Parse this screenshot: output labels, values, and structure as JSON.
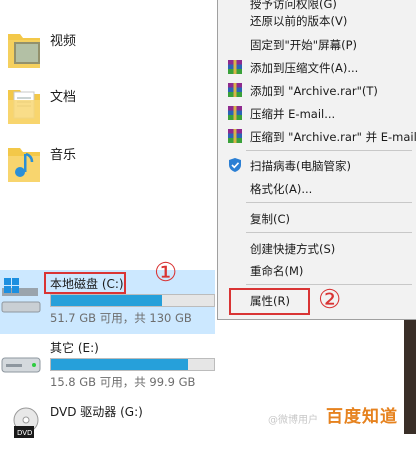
{
  "folders": [
    {
      "label": "视频",
      "icon": "video-folder-icon"
    },
    {
      "label": "文档",
      "icon": "document-folder-icon"
    },
    {
      "label": "音乐",
      "icon": "music-folder-icon"
    }
  ],
  "drives": [
    {
      "name": "本地磁盘 (C:)",
      "space": "51.7 GB 可用，共 130 GB",
      "used_fraction": 0.6,
      "icon": "windows-drive-icon",
      "selected": true
    },
    {
      "name": "其它 (E:)",
      "space": "15.8 GB 可用，共 99.9 GB",
      "used_fraction": 0.84,
      "icon": "hard-drive-icon",
      "selected": false
    },
    {
      "name": "DVD 驱动器 (G:)",
      "icon": "dvd-drive-icon"
    }
  ],
  "annotations": {
    "circle_one": "①",
    "circle_two": "②"
  },
  "context_menu": {
    "items": [
      {
        "label": "授予访问权限(G)"
      },
      {
        "label": "还原以前的版本(V)"
      },
      {
        "label": "固定到\"开始\"屏幕(P)"
      },
      {
        "label": "添加到压缩文件(A)...",
        "icon": "winrar-icon"
      },
      {
        "label": "添加到 \"Archive.rar\"(T)",
        "icon": "winrar-icon"
      },
      {
        "label": "压缩并 E-mail...",
        "icon": "winrar-icon"
      },
      {
        "label": "压缩到 \"Archive.rar\" 并 E-mail",
        "icon": "winrar-icon"
      },
      {
        "label": "扫描病毒(电脑管家)",
        "icon": "shield-icon"
      },
      {
        "label": "格式化(A)..."
      },
      {
        "label": "复制(C)"
      },
      {
        "label": "创建快捷方式(S)"
      },
      {
        "label": "重命名(M)"
      },
      {
        "label": "属性(R)"
      }
    ]
  },
  "watermark": {
    "text": "百度知道",
    "small": "@微博用户"
  },
  "colors": {
    "accent": "#26a0da",
    "selection": "#cce8ff",
    "annotation": "#d93434"
  }
}
